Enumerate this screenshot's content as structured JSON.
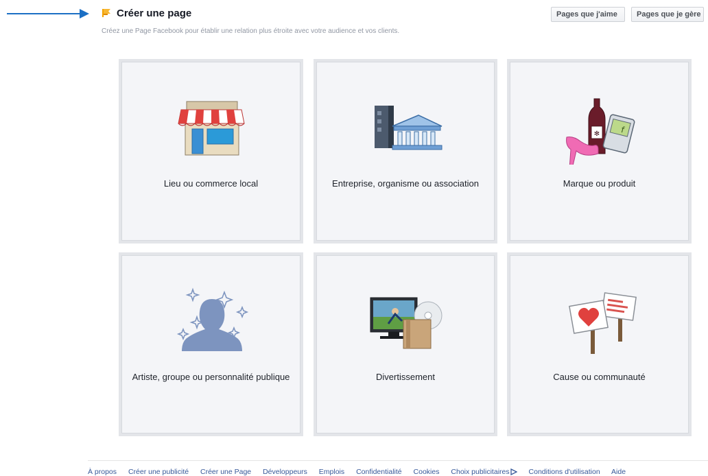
{
  "header": {
    "title": "Créer une page",
    "subtitle": "Créez une Page Facebook pour établir une relation plus étroite avec votre audience et vos clients.",
    "btn_liked": "Pages que j'aime",
    "btn_managed": "Pages que je gère"
  },
  "categories": [
    {
      "label": "Lieu ou commerce local",
      "icon": "storefront-icon"
    },
    {
      "label": "Entreprise, organisme ou association",
      "icon": "company-building-icon"
    },
    {
      "label": "Marque ou produit",
      "icon": "brand-product-icon"
    },
    {
      "label": "Artiste, groupe ou personnalité publique",
      "icon": "public-figure-icon"
    },
    {
      "label": "Divertissement",
      "icon": "entertainment-icon"
    },
    {
      "label": "Cause ou communauté",
      "icon": "cause-community-icon"
    }
  ],
  "footer": {
    "links": [
      "À propos",
      "Créer une publicité",
      "Créer une Page",
      "Développeurs",
      "Emplois",
      "Confidentialité",
      "Cookies",
      "Choix publicitaires",
      "Conditions d'utilisation",
      "Aide"
    ]
  },
  "colors": {
    "card_bg": "#f4f5f8",
    "card_border": "#e3e5e9",
    "link": "#365899",
    "arrow": "#1b6fc4",
    "flag": "#f4a300"
  }
}
